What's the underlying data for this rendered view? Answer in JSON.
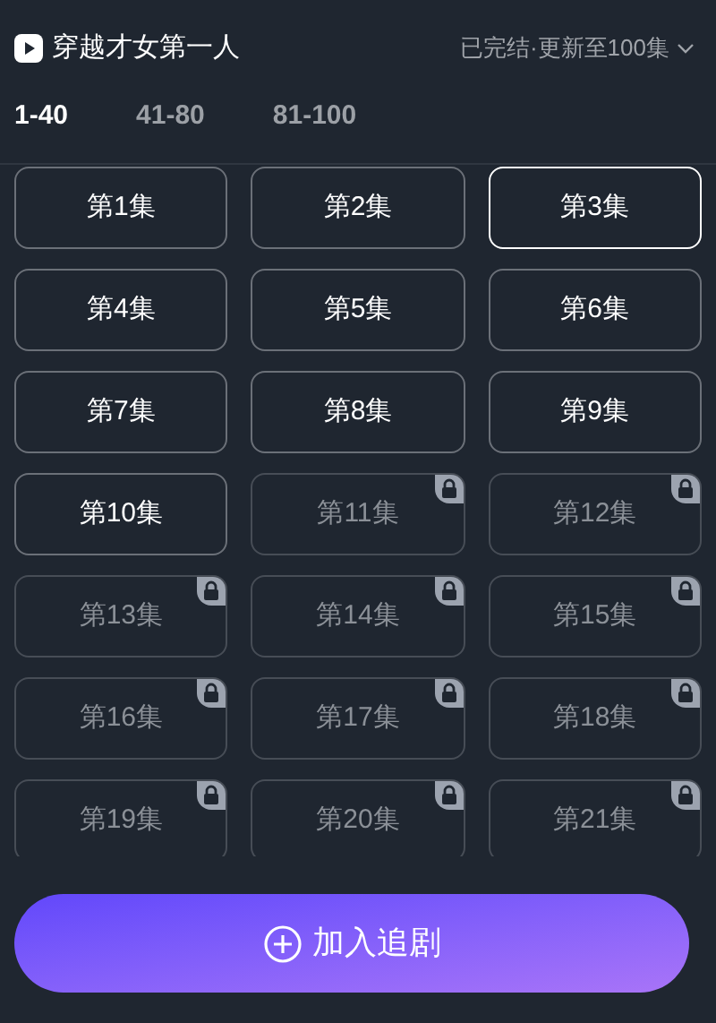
{
  "title": "穿越才女第一人",
  "status": "已完结·更新至100集",
  "tabs": [
    {
      "label": "1-40",
      "selected": true
    },
    {
      "label": "41-80",
      "selected": false
    },
    {
      "label": "81-100",
      "selected": false
    }
  ],
  "episodes": [
    {
      "label": "第1集",
      "selected": false,
      "locked": false
    },
    {
      "label": "第2集",
      "selected": false,
      "locked": false
    },
    {
      "label": "第3集",
      "selected": true,
      "locked": false
    },
    {
      "label": "第4集",
      "selected": false,
      "locked": false
    },
    {
      "label": "第5集",
      "selected": false,
      "locked": false
    },
    {
      "label": "第6集",
      "selected": false,
      "locked": false
    },
    {
      "label": "第7集",
      "selected": false,
      "locked": false
    },
    {
      "label": "第8集",
      "selected": false,
      "locked": false
    },
    {
      "label": "第9集",
      "selected": false,
      "locked": false
    },
    {
      "label": "第10集",
      "selected": false,
      "locked": false
    },
    {
      "label": "第11集",
      "selected": false,
      "locked": true
    },
    {
      "label": "第12集",
      "selected": false,
      "locked": true
    },
    {
      "label": "第13集",
      "selected": false,
      "locked": true
    },
    {
      "label": "第14集",
      "selected": false,
      "locked": true
    },
    {
      "label": "第15集",
      "selected": false,
      "locked": true
    },
    {
      "label": "第16集",
      "selected": false,
      "locked": true
    },
    {
      "label": "第17集",
      "selected": false,
      "locked": true
    },
    {
      "label": "第18集",
      "selected": false,
      "locked": true
    },
    {
      "label": "第19集",
      "selected": false,
      "locked": true
    },
    {
      "label": "第20集",
      "selected": false,
      "locked": true
    },
    {
      "label": "第21集",
      "selected": false,
      "locked": true
    }
  ],
  "action_button": "加入追剧"
}
